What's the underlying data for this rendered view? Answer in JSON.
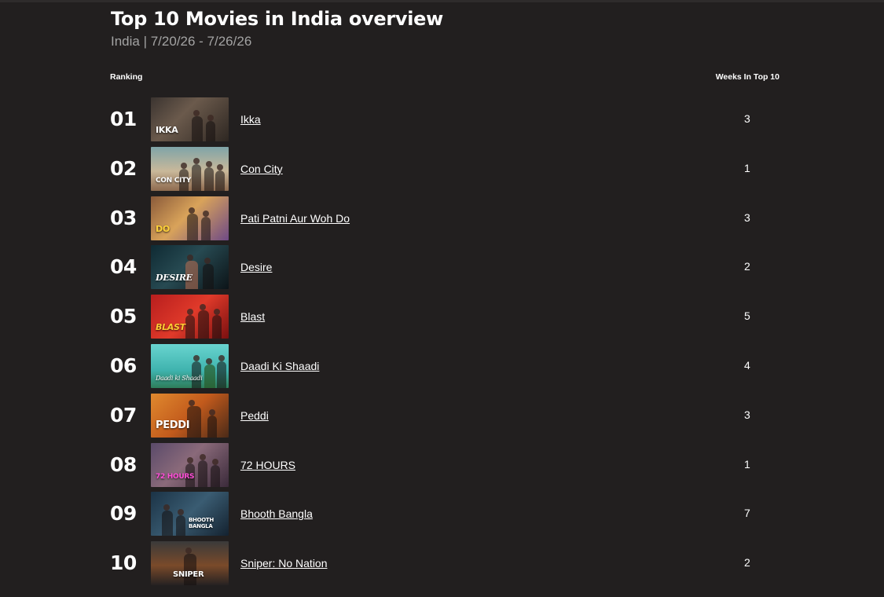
{
  "header": {
    "title": "Top 10 Movies in India overview",
    "subtitle": "India | 7/20/26 - 7/26/26"
  },
  "columns": {
    "ranking": "Ranking",
    "weeks": "Weeks In Top 10"
  },
  "rows": [
    {
      "rank": "01",
      "poster_text": "IKKA",
      "title": "Ikka",
      "weeks": "3"
    },
    {
      "rank": "02",
      "poster_text": "CON CITY",
      "title": "Con City",
      "weeks": "1"
    },
    {
      "rank": "03",
      "poster_text": "DO",
      "title": "Pati Patni Aur Woh Do",
      "weeks": "3"
    },
    {
      "rank": "04",
      "poster_text": "DESIRE",
      "title": "Desire",
      "weeks": "2"
    },
    {
      "rank": "05",
      "poster_text": "BLAST",
      "title": "Blast",
      "weeks": "5"
    },
    {
      "rank": "06",
      "poster_text": "Daadi ki Shaadi",
      "title": "Daadi Ki Shaadi",
      "weeks": "4"
    },
    {
      "rank": "07",
      "poster_text": "PEDDI",
      "title": "Peddi",
      "weeks": "3"
    },
    {
      "rank": "08",
      "poster_text": "72 HOURS",
      "title": "72 HOURS",
      "weeks": "1"
    },
    {
      "rank": "09",
      "poster_text": "BHOOTH BANGLA",
      "title": "Bhooth Bangla",
      "weeks": "7"
    },
    {
      "rank": "10",
      "poster_text": "SNIPER",
      "title": "Sniper: No Nation",
      "weeks": "2"
    }
  ],
  "colors": {
    "background": "#221f1f",
    "text": "#ffffff",
    "subtitle": "#a3a3a3"
  }
}
